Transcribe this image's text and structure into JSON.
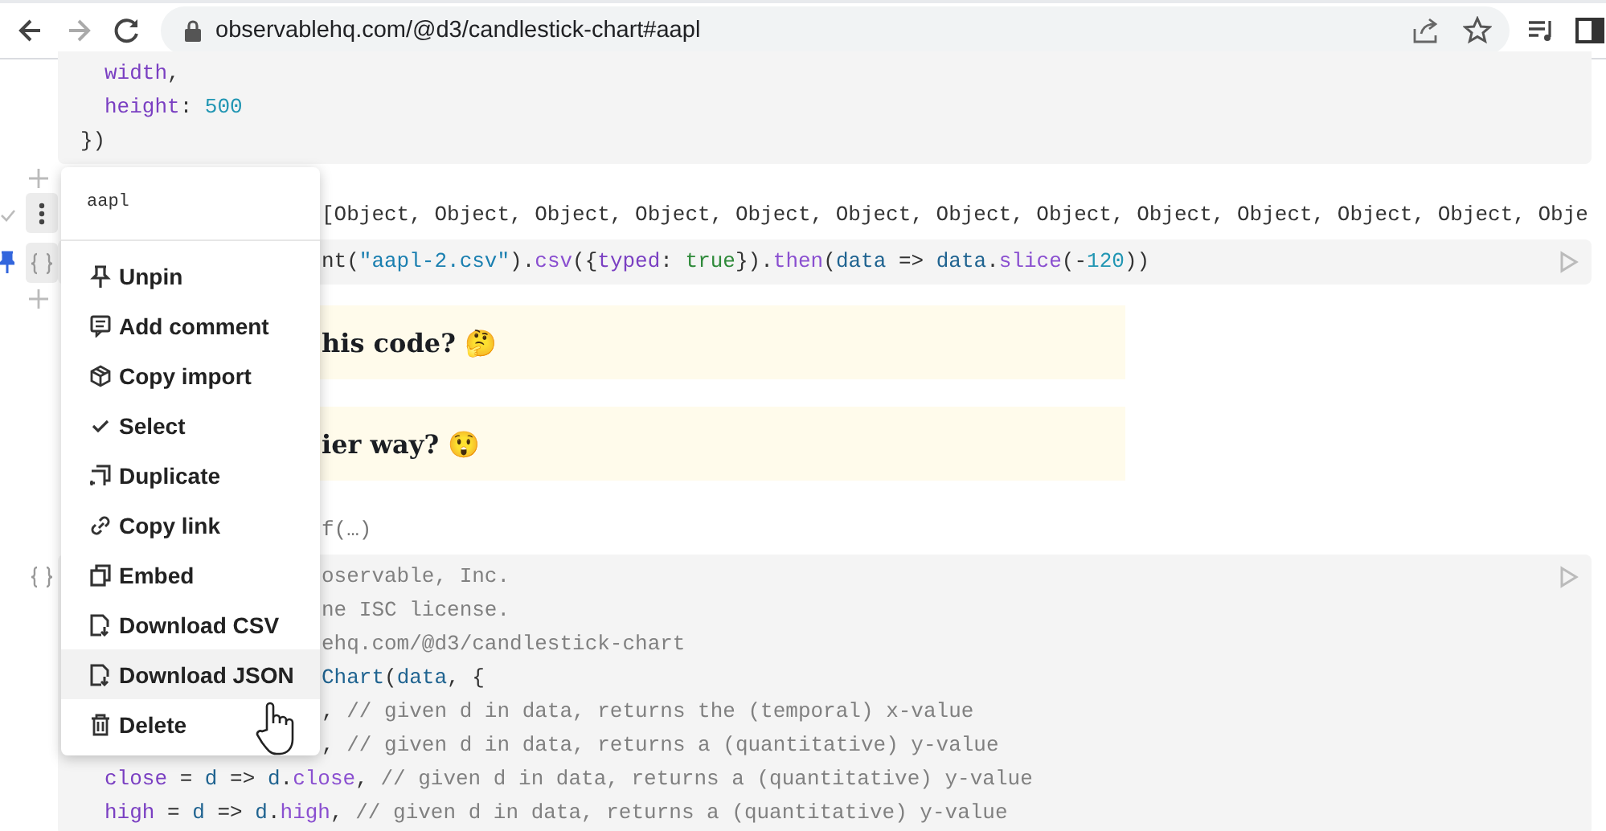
{
  "browser": {
    "url": "observablehq.com/@d3/candlestick-chart#aapl"
  },
  "cells": [
    {
      "kind": "code",
      "lines": [
        {
          "kind": "indent",
          "tokens": [
            {
              "text": "width",
              "kind": "var"
            },
            {
              "text": ","
            }
          ]
        },
        {
          "kind": "indent",
          "tokens": [
            {
              "text": "height",
              "kind": "var"
            },
            {
              "text": ": "
            },
            {
              "text": "500",
              "kind": "num"
            }
          ]
        },
        {
          "kind": "full",
          "tokens": [
            {
              "text": "})"
            }
          ]
        }
      ]
    },
    {
      "kind": "insert"
    },
    {
      "kind": "output",
      "checked": true,
      "menu_open": true,
      "lines": [
        {
          "kind": "partial",
          "tokens": [
            {
              "text": "[Object, Object, Object, Object, Object, Object, Object, Object, Object, Object, Object, Object, Obje"
            }
          ]
        }
      ]
    },
    {
      "kind": "code",
      "pinned": true,
      "run": true,
      "lines": [
        {
          "kind": "partial",
          "tokens": [
            {
              "text": "nt("
            },
            {
              "text": "\"aapl-2.csv\"",
              "kind": "str"
            },
            {
              "text": ")."
            },
            {
              "text": "csv",
              "kind": "fn"
            },
            {
              "text": "({"
            },
            {
              "text": "typed",
              "kind": "var"
            },
            {
              "text": ": "
            },
            {
              "text": "true",
              "kind": "bool"
            },
            {
              "text": "})."
            },
            {
              "text": "then",
              "kind": "fn"
            },
            {
              "text": "("
            },
            {
              "text": "data",
              "kind": "ref"
            },
            {
              "text": " => "
            },
            {
              "text": "data",
              "kind": "ref"
            },
            {
              "text": "."
            },
            {
              "text": "slice",
              "kind": "fn"
            },
            {
              "text": "(-"
            },
            {
              "text": "120",
              "kind": "num"
            },
            {
              "text": "))"
            }
          ]
        }
      ]
    },
    {
      "kind": "insert"
    },
    {
      "kind": "prose",
      "text": "his code? 🤔"
    },
    {
      "kind": "prose",
      "text": "ier way? 😲"
    },
    {
      "kind": "output",
      "checked": false,
      "menu_open": false,
      "lines": [
        {
          "kind": "partial",
          "tokens": [
            {
              "text": "f(…)",
              "kind": "dim"
            }
          ]
        }
      ]
    },
    {
      "kind": "code",
      "pinned": false,
      "run": true,
      "lines": [
        {
          "kind": "partial",
          "tokens": [
            {
              "text": "oservable, Inc.",
              "kind": "comment"
            }
          ]
        },
        {
          "kind": "partial",
          "tokens": [
            {
              "text": "ne ISC license.",
              "kind": "comment"
            }
          ]
        },
        {
          "kind": "partial",
          "tokens": [
            {
              "text": "ehq.com/@d3/candlestick-chart",
              "kind": "comment"
            }
          ]
        },
        {
          "kind": "partial",
          "tokens": [
            {
              "text": "Chart",
              "kind": "ref"
            },
            {
              "text": "("
            },
            {
              "text": "data",
              "kind": "ref"
            },
            {
              "text": ", {"
            }
          ]
        },
        {
          "kind": "partial",
          "tokens": [
            {
              "text": ", "
            },
            {
              "text": "// given d in data, returns the (temporal) x-value",
              "kind": "comment"
            }
          ]
        },
        {
          "kind": "partial",
          "tokens": [
            {
              "text": ", "
            },
            {
              "text": "// given d in data, returns a (quantitative) y-value",
              "kind": "comment"
            }
          ]
        },
        {
          "kind": "indent",
          "tokens": [
            {
              "text": "close",
              "kind": "var"
            },
            {
              "text": " = "
            },
            {
              "text": "d",
              "kind": "ref"
            },
            {
              "text": " => "
            },
            {
              "text": "d",
              "kind": "ref"
            },
            {
              "text": "."
            },
            {
              "text": "close",
              "kind": "fn"
            },
            {
              "text": ", "
            },
            {
              "text": "// given d in data, returns a (quantitative) y-value",
              "kind": "comment"
            }
          ]
        },
        {
          "kind": "indent",
          "tokens": [
            {
              "text": "high",
              "kind": "var"
            },
            {
              "text": " = "
            },
            {
              "text": "d",
              "kind": "ref"
            },
            {
              "text": " => "
            },
            {
              "text": "d",
              "kind": "ref"
            },
            {
              "text": "."
            },
            {
              "text": "high",
              "kind": "fn"
            },
            {
              "text": ", "
            },
            {
              "text": "// given d in data, returns a (quantitative) y-value",
              "kind": "comment"
            }
          ]
        }
      ]
    }
  ],
  "menu": {
    "title": "aapl",
    "items": [
      {
        "label": "Unpin",
        "selected": false
      },
      {
        "label": "Add comment",
        "selected": false
      },
      {
        "label": "Copy import",
        "selected": false
      },
      {
        "label": "Select",
        "selected": false
      },
      {
        "label": "Duplicate",
        "selected": false
      },
      {
        "label": "Copy link",
        "selected": false
      },
      {
        "label": "Embed",
        "selected": false
      },
      {
        "label": "Download CSV",
        "selected": false
      },
      {
        "label": "Download JSON",
        "selected": true
      },
      {
        "label": "Delete",
        "selected": false
      }
    ]
  }
}
